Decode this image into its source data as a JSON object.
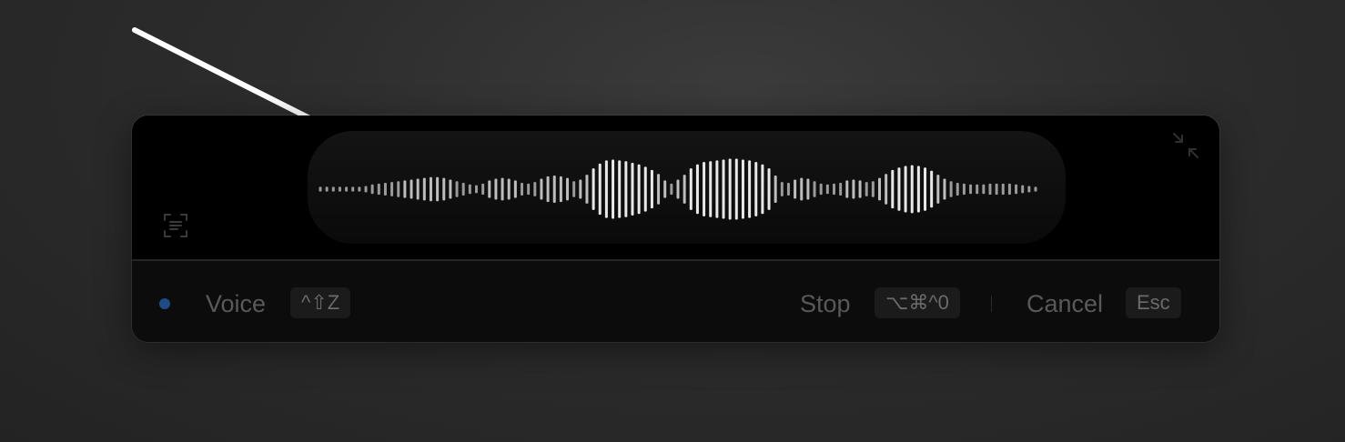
{
  "window": {
    "voice_label": "Voice",
    "voice_shortcut": "^⇧Z",
    "stop_label": "Stop",
    "stop_shortcut": "⌥⌘^0",
    "cancel_label": "Cancel",
    "cancel_shortcut": "Esc"
  },
  "icons": {
    "collapse": "collapse-icon",
    "screen": "screen-text-icon",
    "status_dot": "recording-status-dot",
    "annotation": "arrow-annotation"
  },
  "waveform": {
    "levels": [
      0.06,
      0.06,
      0.06,
      0.06,
      0.06,
      0.06,
      0.06,
      0.08,
      0.12,
      0.14,
      0.16,
      0.18,
      0.2,
      0.22,
      0.24,
      0.26,
      0.28,
      0.3,
      0.3,
      0.28,
      0.24,
      0.2,
      0.16,
      0.12,
      0.1,
      0.14,
      0.22,
      0.26,
      0.28,
      0.26,
      0.22,
      0.16,
      0.14,
      0.18,
      0.26,
      0.32,
      0.34,
      0.32,
      0.28,
      0.2,
      0.24,
      0.36,
      0.52,
      0.64,
      0.72,
      0.74,
      0.72,
      0.7,
      0.66,
      0.62,
      0.56,
      0.48,
      0.38,
      0.22,
      0.14,
      0.24,
      0.36,
      0.52,
      0.62,
      0.68,
      0.7,
      0.72,
      0.74,
      0.76,
      0.76,
      0.74,
      0.72,
      0.68,
      0.62,
      0.52,
      0.34,
      0.18,
      0.16,
      0.24,
      0.28,
      0.26,
      0.2,
      0.14,
      0.12,
      0.14,
      0.16,
      0.22,
      0.24,
      0.22,
      0.18,
      0.2,
      0.28,
      0.38,
      0.48,
      0.54,
      0.58,
      0.6,
      0.58,
      0.54,
      0.46,
      0.36,
      0.26,
      0.2,
      0.16,
      0.14,
      0.12,
      0.12,
      0.12,
      0.14,
      0.14,
      0.14,
      0.14,
      0.12,
      0.1,
      0.08,
      0.06
    ],
    "bar_color": "#e8e8e8"
  },
  "colors": {
    "status_dot": "#1f4b84",
    "muted_text": "#595959"
  }
}
